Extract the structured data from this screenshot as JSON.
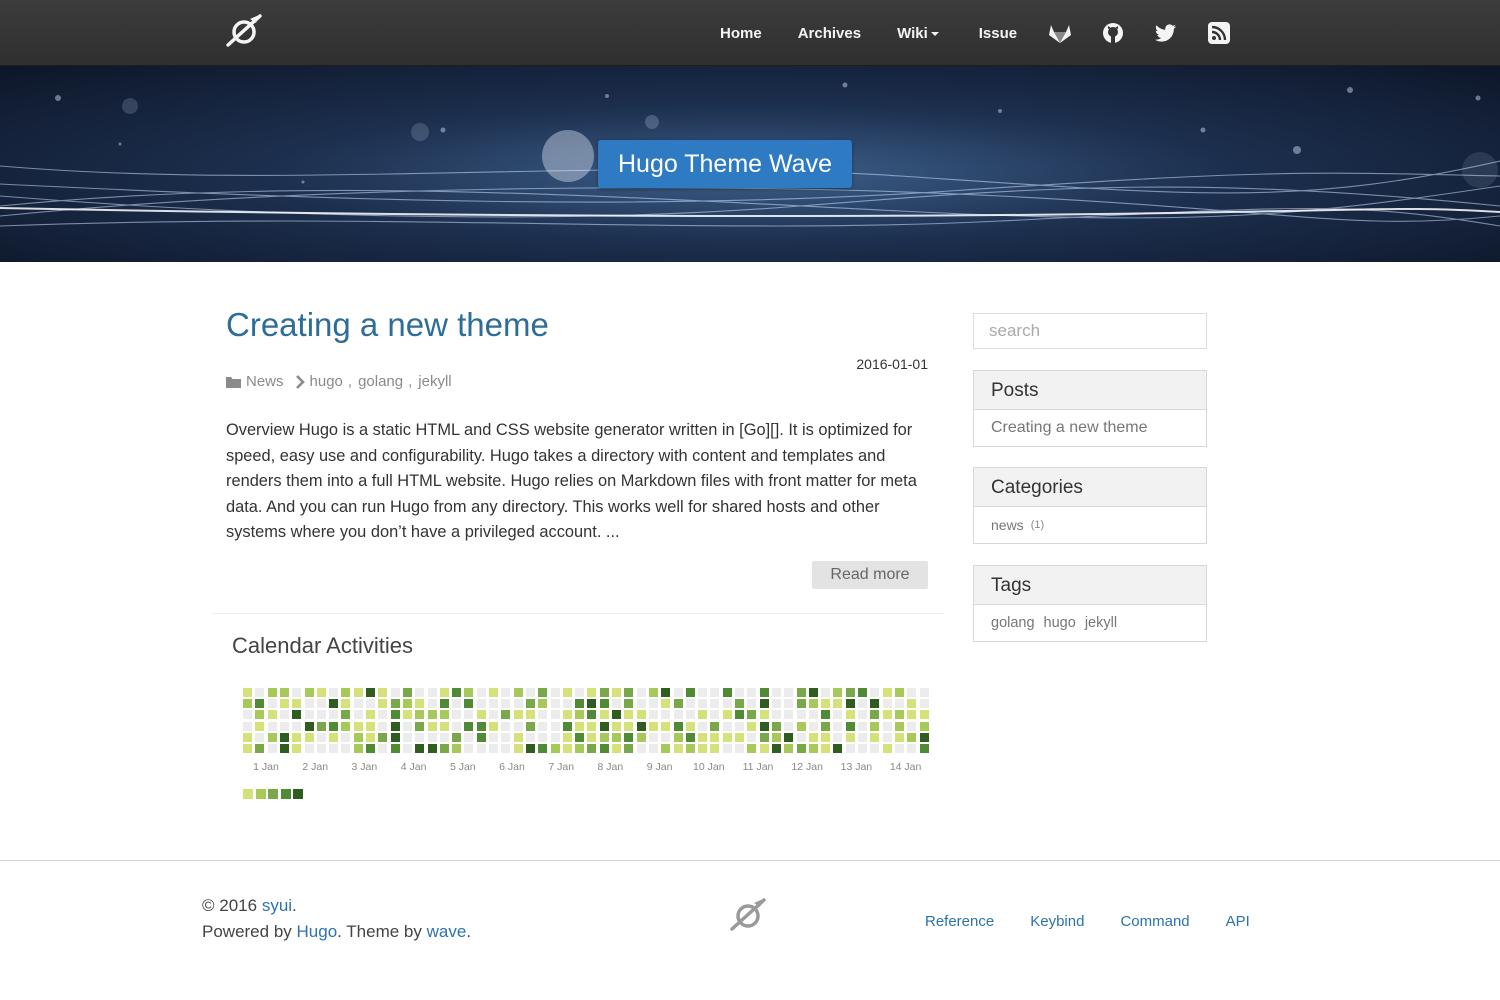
{
  "navbar": {
    "links": [
      {
        "label": "Home"
      },
      {
        "label": "Archives"
      },
      {
        "label": "Wiki"
      },
      {
        "label": "Issue"
      }
    ],
    "icons": [
      "gitlab-icon",
      "github-icon",
      "twitter-icon",
      "rss-icon"
    ]
  },
  "hero": {
    "title": "Hugo Theme Wave"
  },
  "post": {
    "title": "Creating a new theme",
    "date": "2016-01-01",
    "category": "News",
    "tags": [
      "hugo",
      "golang",
      "jekyll"
    ],
    "separator": ",",
    "body": "Overview Hugo is a static HTML and CSS website generator written in [Go][]. It is optimized for speed, easy use and configurability. Hugo takes a directory with content and templates and renders them into a full HTML website. Hugo relies on Markdown files with front matter for meta data. And you can run Hugo from any directory. This works well for shared hosts and other systems where you don’t have a privileged account. ...",
    "read_more": "Read more"
  },
  "calendar": {
    "title": "Calendar Activities",
    "day_labels": [
      "1 Jan",
      "2 Jan",
      "3 Jan",
      "4 Jan",
      "5 Jan",
      "6 Jan",
      "7 Jan",
      "8 Jan",
      "9 Jan",
      "10 Jan",
      "11 Jan",
      "12 Jan",
      "13 Jan",
      "14 Jan"
    ],
    "levels_colors": [
      "#ececec",
      "#d5e27a",
      "#a7c95a",
      "#78a84a",
      "#4f8a35",
      "#2f5c1f"
    ]
  },
  "sidebar": {
    "search_placeholder": "search",
    "posts": {
      "title": "Posts",
      "items": [
        "Creating a new theme"
      ]
    },
    "categories": {
      "title": "Categories",
      "items": [
        {
          "name": "news",
          "count": "(1)"
        }
      ]
    },
    "tags": {
      "title": "Tags",
      "items": [
        "golang",
        "hugo",
        "jekyll"
      ]
    }
  },
  "footer": {
    "copyright": "© 2016",
    "author": "syui",
    "period": ".",
    "powered_prefix": "Powered by",
    "powered_link": "Hugo",
    "theme_text": ". Theme by",
    "theme_link": "wave",
    "links": [
      "Reference",
      "Keybind",
      "Command",
      "API"
    ]
  }
}
